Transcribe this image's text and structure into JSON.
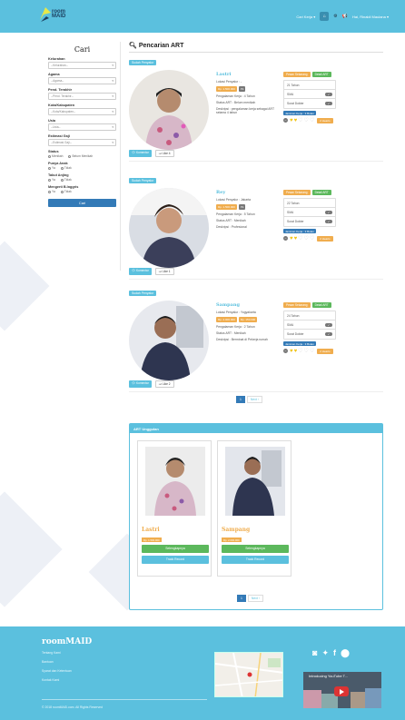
{
  "navbar": {
    "logo_text_1": "room",
    "logo_text_2": "MAID",
    "menu_1": "Cari Kerja ▾",
    "user": "Hai, Rinaldi Maulana ▾"
  },
  "sidebar": {
    "title": "Cari",
    "filters": [
      {
        "label": "Kelurahan",
        "placeholder": "--Kelurahan--"
      },
      {
        "label": "Agama",
        "placeholder": "--Agama--"
      },
      {
        "label": "Pend. Terakhir",
        "placeholder": "--Pend. Terakhir--"
      },
      {
        "label": "Kota/Kabupaten",
        "placeholder": "--Kota/Kabupaten--"
      },
      {
        "label": "Usia",
        "placeholder": "--Usia--"
      },
      {
        "label": "Estimasi Gaji",
        "placeholder": "--Estimasi Gaji--"
      }
    ],
    "status": {
      "label": "Status",
      "opt1": "Menikah",
      "opt2": "Belum Menikah"
    },
    "anak": {
      "label": "Punya Anak",
      "opt1": "Ya",
      "opt2": "Tidak"
    },
    "anjing": {
      "label": "Takut Anjing",
      "opt1": "Ya",
      "opt2": "Tidak"
    },
    "inggris": {
      "label": "Mengerti B.Inggris",
      "opt1": "Ya",
      "opt2": "Tidak"
    },
    "button": "Cari"
  },
  "main": {
    "title": "Pencarian ART",
    "cards": [
      {
        "tag": "Sudah Penyalur",
        "name": "Lastri",
        "l1": "Lokasi Penyalur : -",
        "b1": "Rp. 1.500.000",
        "b2": "Pk",
        "l2": "Pengalaman Kerja : 4 Tahun",
        "l3": "Status ART : Belum menikah",
        "l4": "Deskripsi : pengalaman kerja sebagai ART selama 4 tahun",
        "btn_o": "Pesan Sekarang",
        "btn_g": "Detail ART",
        "li1": "21 Tahun",
        "li2": "SMA",
        "li3": "Surat Dokter",
        "bar": "Jaminan Kerja : 3 Bulan",
        "heart": "2 Hearts",
        "comment": "Komentar",
        "like": "Like 4"
      },
      {
        "tag": "Sudah Penyalur",
        "name": "Rey",
        "l1": "Lokasi Penyalur : Jakarta",
        "b1": "Rp. 1.500.000",
        "b2": "Pk",
        "l2": "Pengalaman Kerja : 5 Tahun",
        "l3": "Status ART : Menikah",
        "l4": "Deskripsi : Profesional",
        "btn_o": "Pesan Sekarang",
        "btn_g": "Detail ART",
        "li1": "22 Tahun",
        "li2": "SMA",
        "li3": "Surat Dokter",
        "bar": "Jaminan Kerja : 3 Bulan",
        "heart": "2 Hearts",
        "comment": "Komentar",
        "like": "Like 1"
      },
      {
        "tag": "Sudah Penyalur",
        "name": "Sampang",
        "l1": "Lokasi Penyalur : Yogyakarta",
        "b1": "Rp. 2.000.000",
        "b2": "Rp. 150.000",
        "l2": "Pengalaman Kerja : 2 Tahun",
        "l3": "Status ART : Menikah",
        "l4": "Deskripsi : Berminat di Pekerja rumah",
        "btn_o": "Pesan Sekarang",
        "btn_g": "Detail ART",
        "li1": "24 Tahun",
        "li2": "SMA",
        "li3": "Surat Dokter",
        "bar": "Jaminan Kerja : 3 Bulan",
        "heart": "2 Hearts",
        "comment": "Komentar",
        "like": "Like 2"
      }
    ],
    "pager": {
      "page": "1",
      "next": "Next ›"
    }
  },
  "featured": {
    "title": "ART Unggulan",
    "items": [
      {
        "name": "Lastri",
        "badge": "Rp. 1.500.000",
        "btn_g": "Selengkapnya",
        "btn_b": "Track Record"
      },
      {
        "name": "Sampang",
        "badge": "Rp. 2.000.000",
        "btn_g": "Selengkapnya",
        "btn_b": "Track Record"
      }
    ],
    "pager": {
      "page": "1",
      "next": "Next ›"
    }
  },
  "footer": {
    "brand": "roomMAID",
    "links": [
      "Tentang Kami",
      "Bantuan",
      "Syarat dan Ketentuan",
      "Kontak Kami"
    ],
    "copy": "© 2018 roomMAID.com. All Rights Reserved",
    "video_title": "Introducing YouTube T..."
  },
  "colors": {
    "accent": "#5bc0de",
    "primary": "#337ab7",
    "warning": "#f0ad4e",
    "success": "#5cb85c"
  }
}
